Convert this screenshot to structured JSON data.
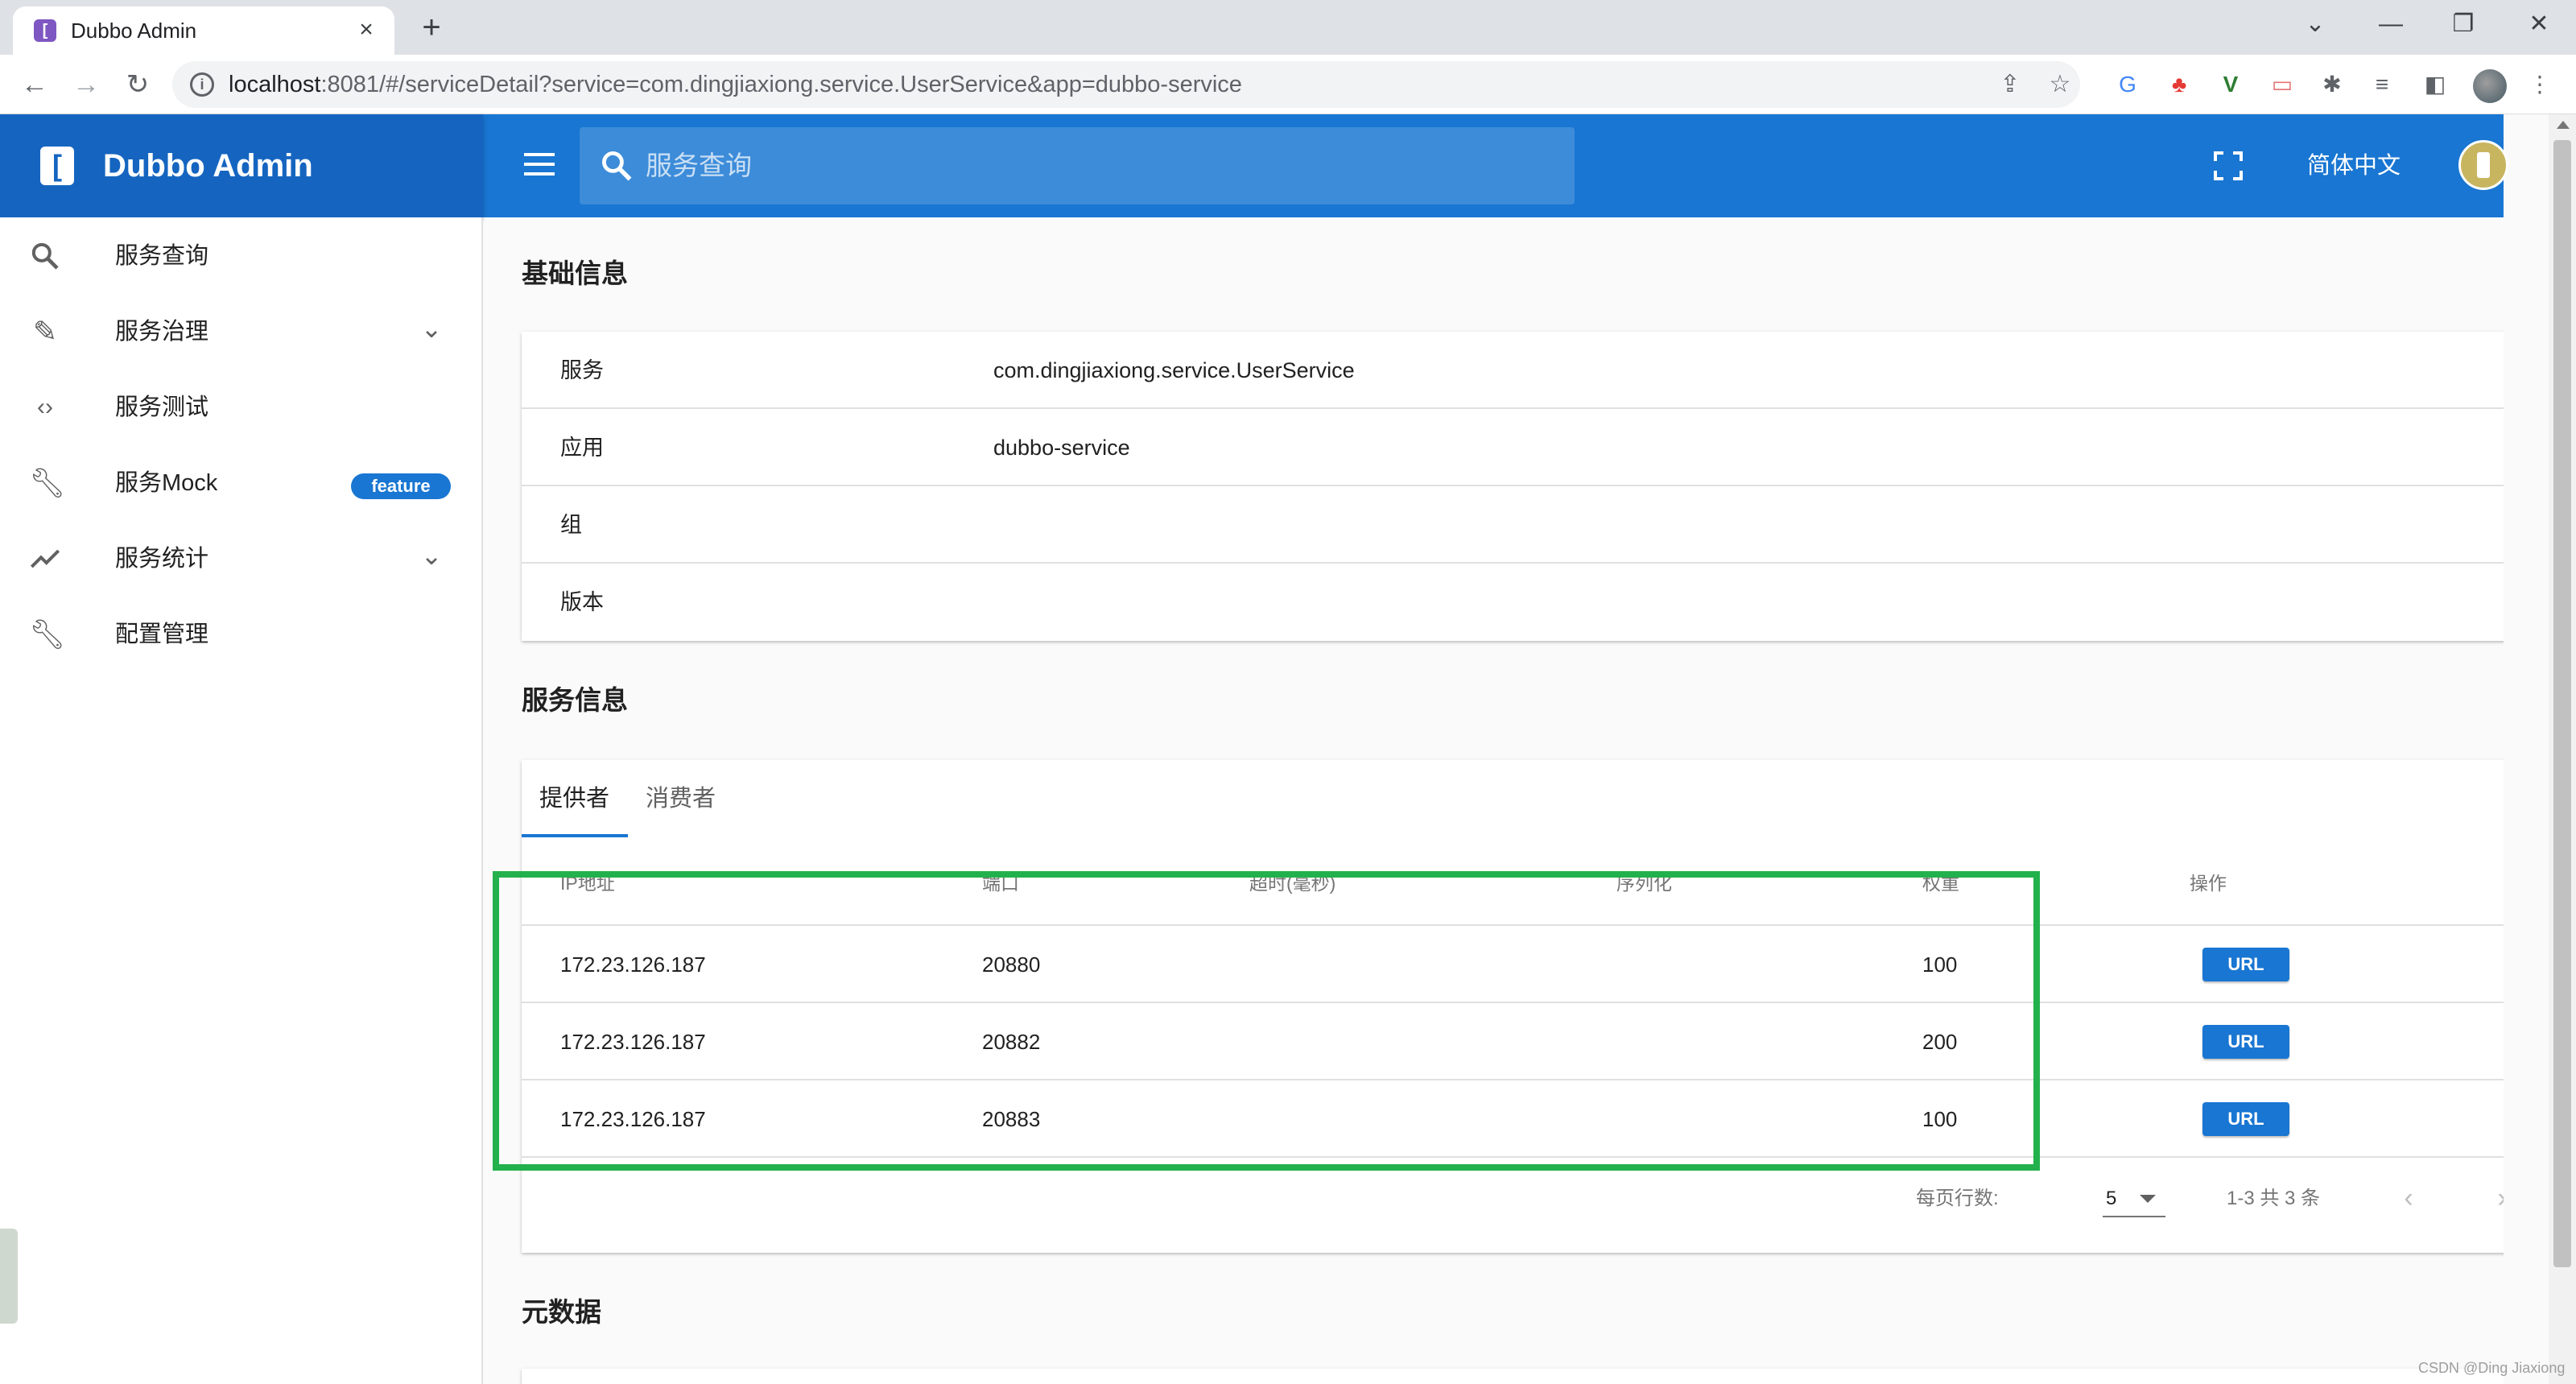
{
  "browser": {
    "tab_title": "Dubbo Admin",
    "tab_favicon": "[",
    "new_tab": "+",
    "url_host": "localhost",
    "url_rest": ":8081/#/serviceDetail?service=com.dingjiaxiong.service.UserService&app=dubbo-service",
    "window_controls": [
      "⌄",
      "—",
      "❐",
      "✕"
    ]
  },
  "appbar": {
    "logo": "[",
    "title": "Dubbo Admin",
    "search_placeholder": "服务查询",
    "lang": "简体中文"
  },
  "sidebar": {
    "items": [
      {
        "label": "服务查询",
        "icon": "search-icon"
      },
      {
        "label": "服务治理",
        "icon": "pencil-icon",
        "expandable": true
      },
      {
        "label": "服务测试",
        "icon": "code-icon"
      },
      {
        "label": "服务Mock",
        "icon": "wrench-icon",
        "badge": "feature"
      },
      {
        "label": "服务统计",
        "icon": "trending-icon",
        "expandable": true
      },
      {
        "label": "配置管理",
        "icon": "wrench-icon"
      }
    ]
  },
  "basic": {
    "title": "基础信息",
    "rows": [
      {
        "key": "服务",
        "value": "com.dingjiaxiong.service.UserService"
      },
      {
        "key": "应用",
        "value": "dubbo-service"
      },
      {
        "key": "组",
        "value": ""
      },
      {
        "key": "版本",
        "value": ""
      }
    ]
  },
  "service": {
    "title": "服务信息",
    "tabs": [
      "提供者",
      "消费者"
    ],
    "active_tab": 0,
    "headers": [
      "IP地址",
      "端口",
      "超时(毫秒)",
      "序列化",
      "权重",
      "操作"
    ],
    "rows": [
      {
        "ip": "172.23.126.187",
        "port": "20880",
        "timeout": "",
        "serialization": "",
        "weight": "100",
        "action": "URL"
      },
      {
        "ip": "172.23.126.187",
        "port": "20882",
        "timeout": "",
        "serialization": "",
        "weight": "200",
        "action": "URL"
      },
      {
        "ip": "172.23.126.187",
        "port": "20883",
        "timeout": "",
        "serialization": "",
        "weight": "100",
        "action": "URL"
      }
    ],
    "footer": {
      "rows_per_page_label": "每页行数:",
      "rows_per_page_value": "5",
      "range": "1-3 共 3 条"
    }
  },
  "metadata": {
    "title": "元数据"
  },
  "watermark": "CSDN @Ding Jiaxiong",
  "colors": {
    "primary": "#1976d2",
    "brand": "#1565c0",
    "highlight": "#22b14c"
  }
}
